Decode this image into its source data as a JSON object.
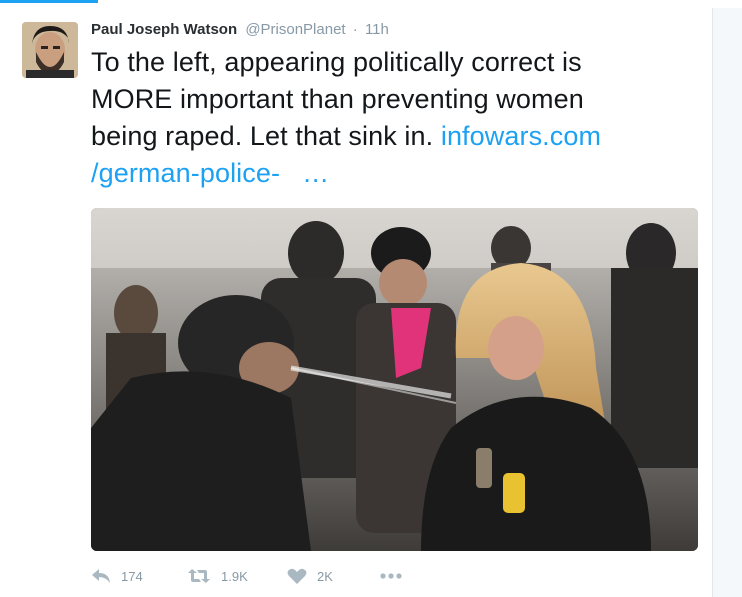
{
  "tweet": {
    "display_name": "Paul Joseph Watson",
    "screen_name": "@PrisonPlanet",
    "separator": "·",
    "timestamp": "11h",
    "text_lines": [
      "To the left, appearing politically correct is",
      "MORE important than preventing women",
      "being raped. Let that sink in. "
    ],
    "link_part1": "infowars.com",
    "link_part2": "/german-police-",
    "link_ellipsis": "…"
  },
  "actions": {
    "reply": {
      "icon": "reply-icon",
      "count": "174"
    },
    "retweet": {
      "icon": "retweet-icon",
      "count": "1.9K"
    },
    "like": {
      "icon": "heart-icon",
      "count": "2K"
    },
    "more": {
      "icon": "more-dots-icon"
    }
  },
  "colors": {
    "accent": "#1da1f2",
    "text": "#14171a",
    "muted": "#8899a6"
  }
}
